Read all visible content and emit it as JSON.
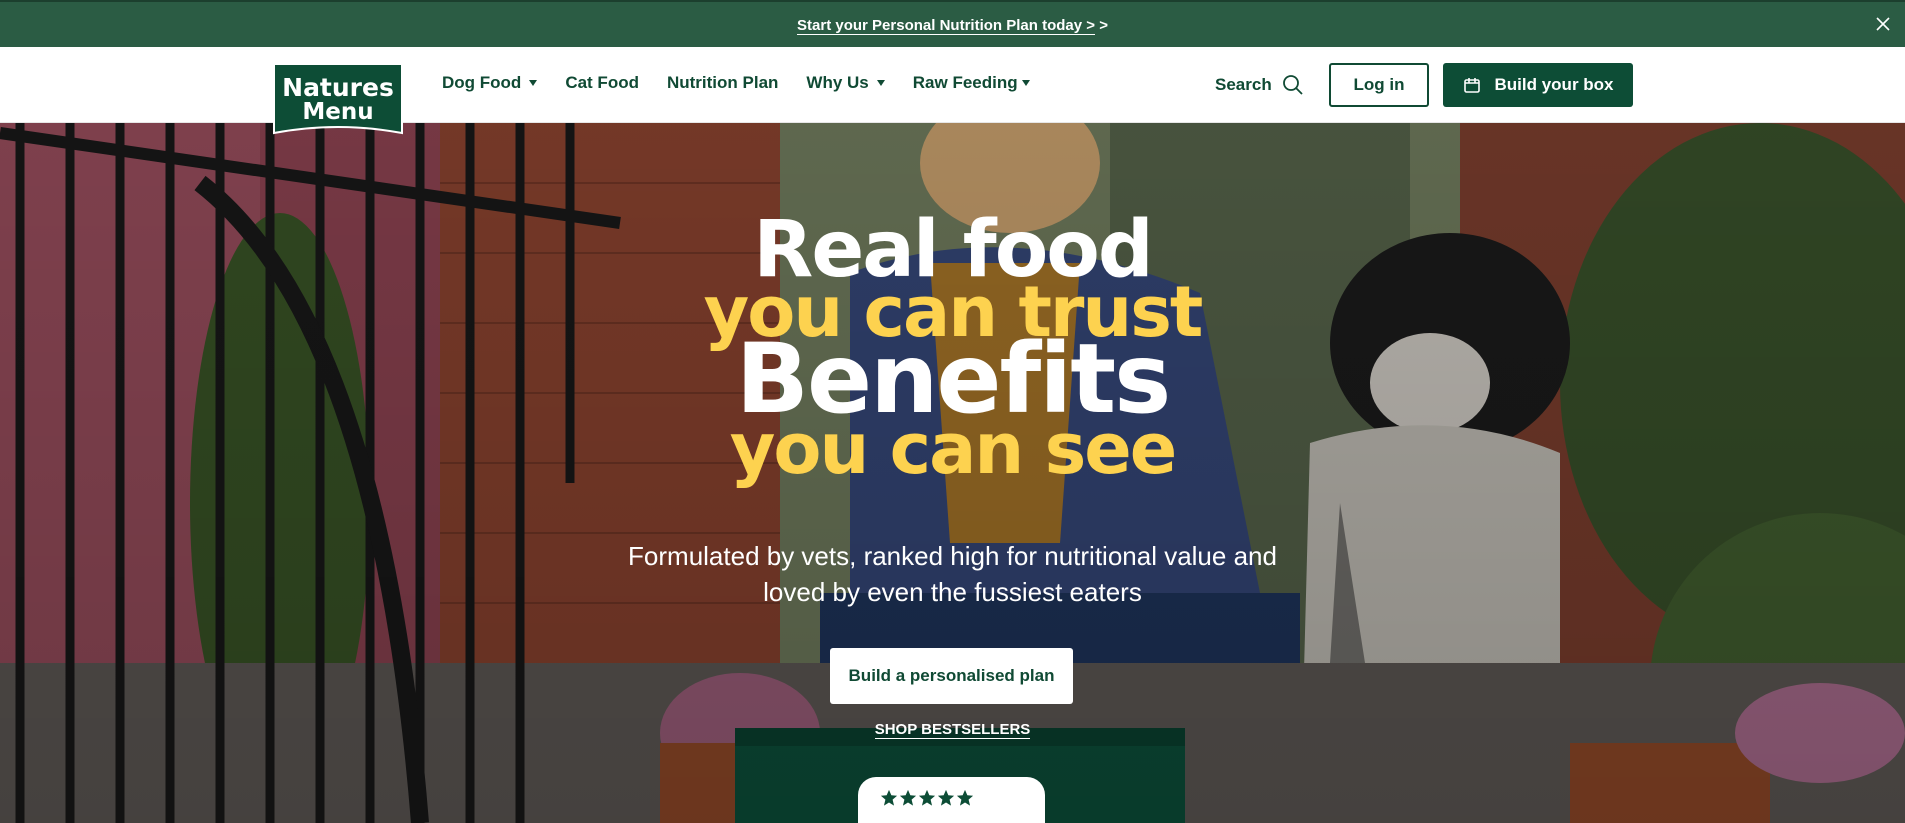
{
  "promo": {
    "text": "Start your Personal Nutrition Plan today >",
    "chevron": ">"
  },
  "header": {
    "logo_line1": "Natures",
    "logo_line2": "Menu",
    "nav": [
      {
        "label": "Dog Food",
        "has_dropdown": true
      },
      {
        "label": "Cat Food",
        "has_dropdown": false
      },
      {
        "label": "Nutrition Plan",
        "has_dropdown": false
      },
      {
        "label": "Why Us",
        "has_dropdown": true
      },
      {
        "label": "Raw Feeding",
        "has_dropdown": true
      }
    ],
    "search_label": "Search",
    "login_label": "Log in",
    "build_box_label": "Build your box"
  },
  "hero": {
    "line1": "Real food",
    "line2": "you can trust",
    "line3": "Benefits",
    "line4": "you can see",
    "subtext_line1": "Formulated by vets, ranked high for nutritional value and",
    "subtext_line2": "loved by even the fussiest eaters",
    "cta_label": "Build a personalised plan",
    "shop_label": "SHOP BESTSELLERS",
    "rating_stars": 5
  },
  "colors": {
    "brand_green": "#0d4d36",
    "promo_green": "#2b5c44",
    "accent_yellow": "#fdd24f"
  }
}
